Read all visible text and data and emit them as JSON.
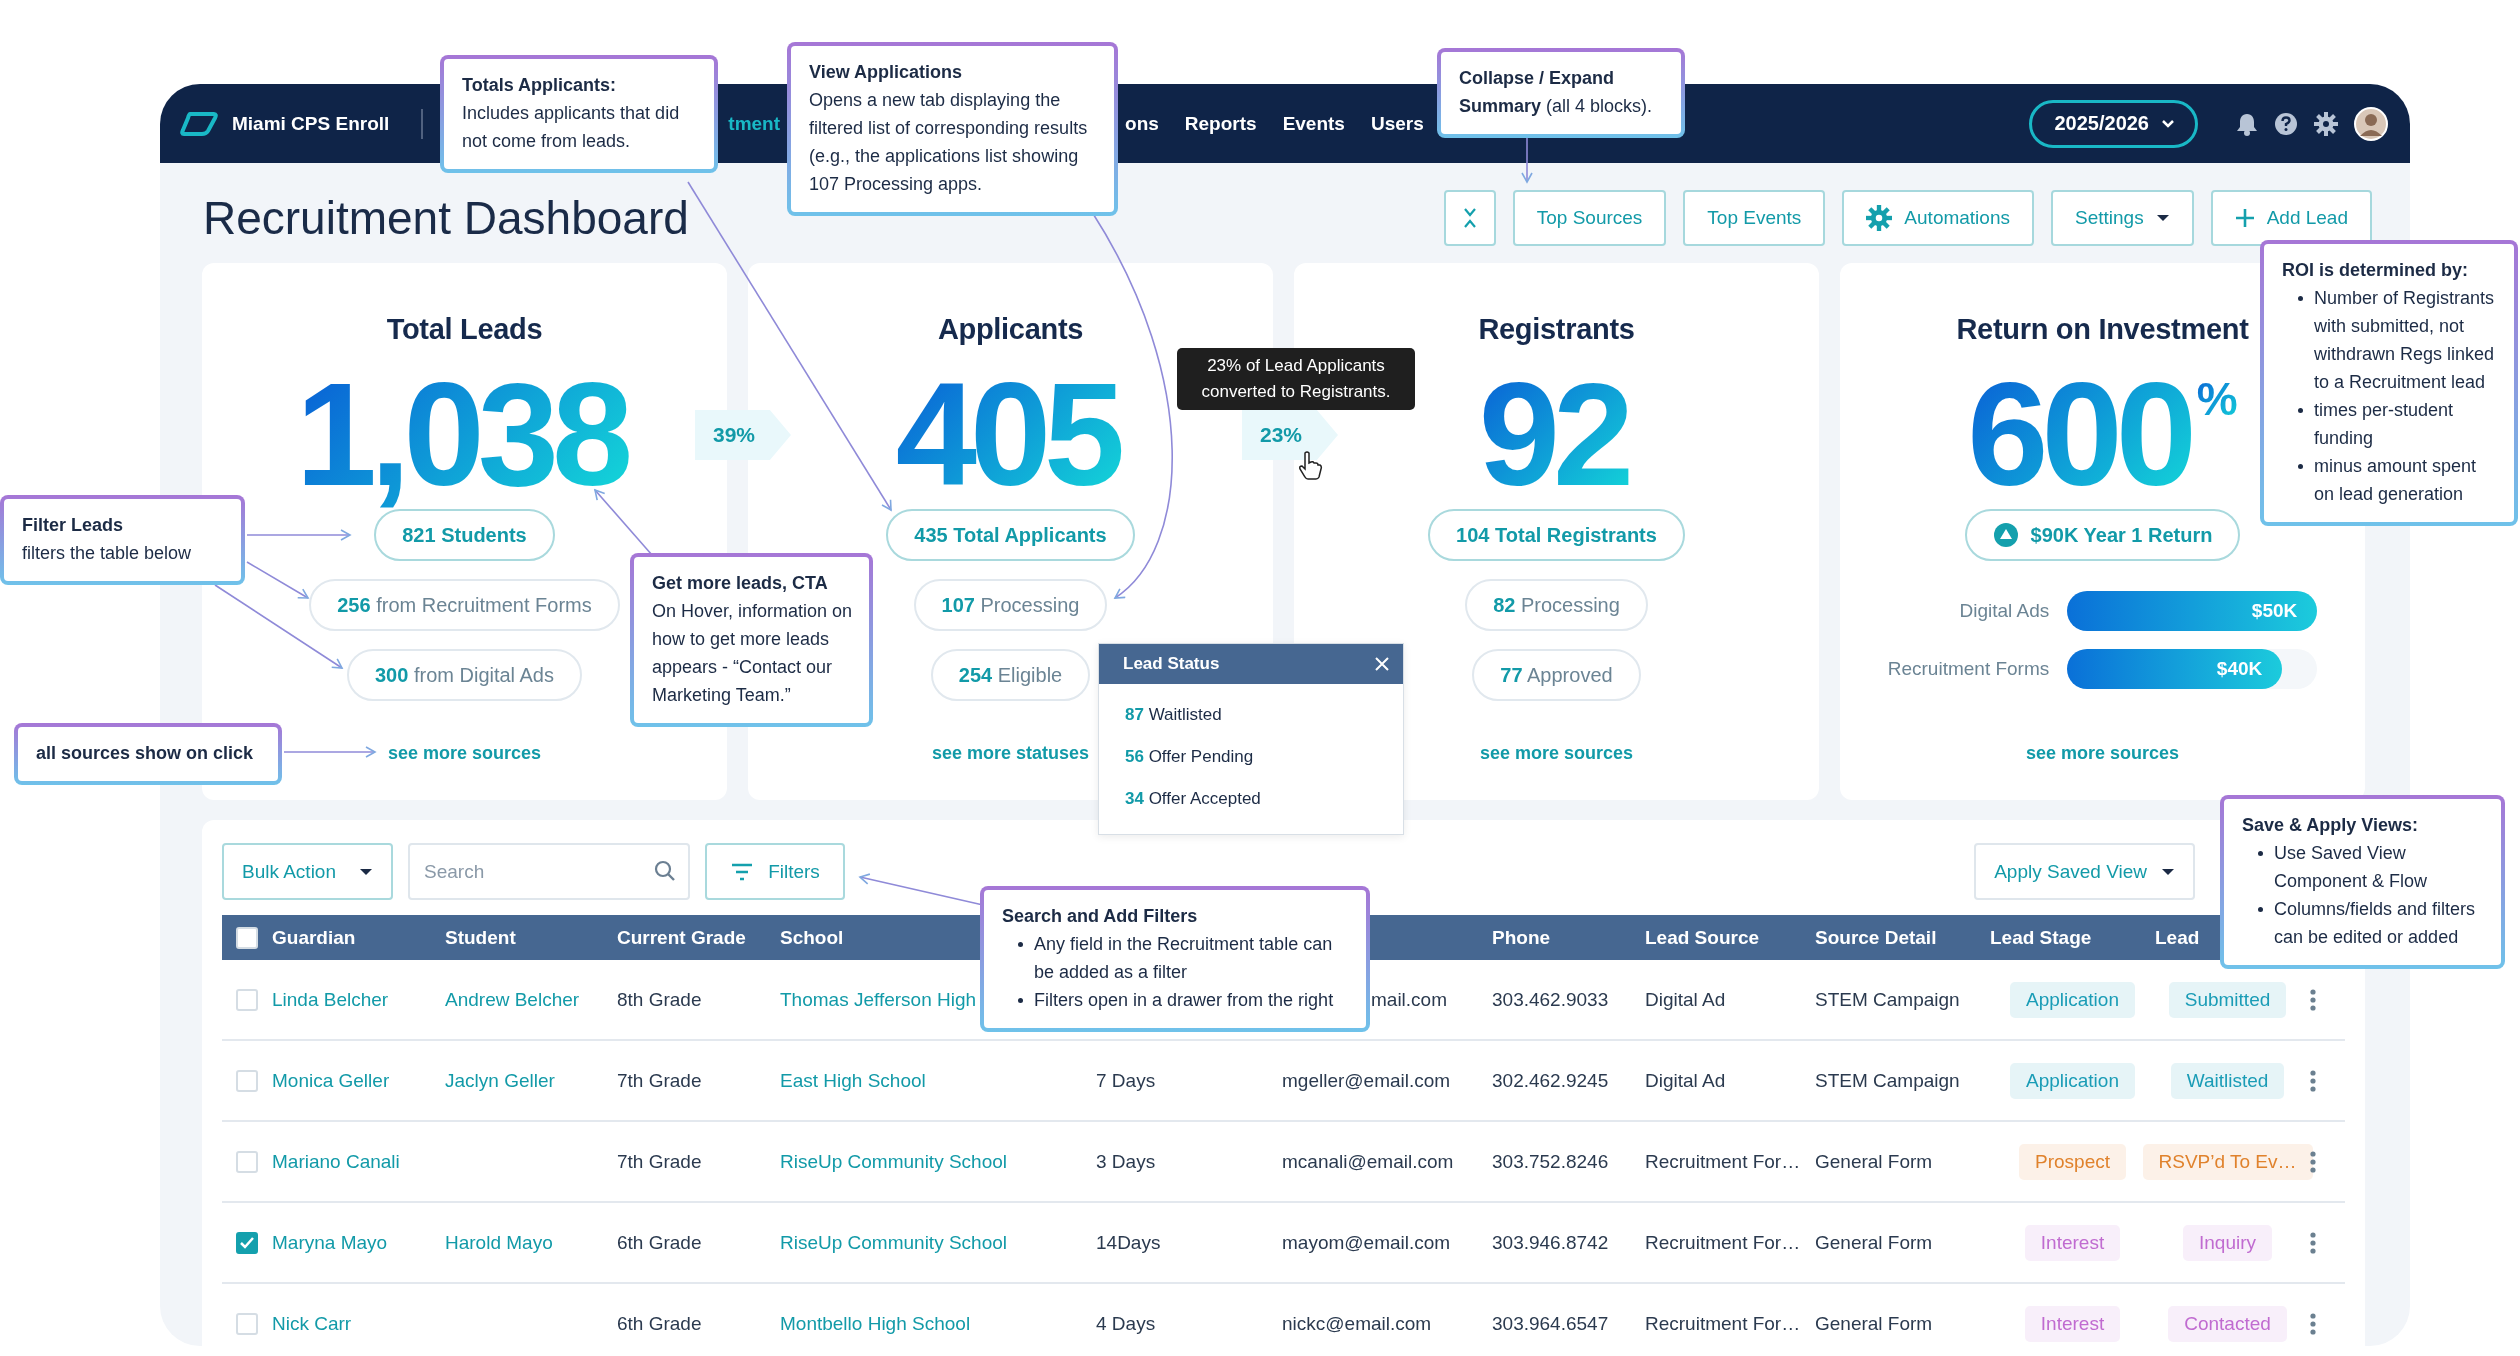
{
  "app": {
    "name": "Miami CPS Enroll"
  },
  "nav": [
    {
      "label": "tment",
      "selected": true
    },
    {
      "label": "ons",
      "selected": false
    },
    {
      "label": "Reports",
      "selected": false
    },
    {
      "label": "Events",
      "selected": false
    },
    {
      "label": "Users",
      "selected": false
    }
  ],
  "year": "2025/2026",
  "page_title": "Recruitment Dashboard",
  "actions": [
    {
      "kind": "collapse"
    },
    {
      "kind": "plain",
      "label": "Top Sources"
    },
    {
      "kind": "plain",
      "label": "Top Events"
    },
    {
      "kind": "gear",
      "label": "Automations"
    },
    {
      "kind": "menu",
      "label": "Settings"
    },
    {
      "kind": "add",
      "label": "Add Lead"
    }
  ],
  "cards": [
    {
      "kind": "stat",
      "title": "Total Leads",
      "value": "1,038",
      "primary": "821 Students",
      "items": [
        {
          "count": "256",
          "label": "from Recruitment Forms"
        },
        {
          "count": "300",
          "label": "from Digital Ads"
        }
      ],
      "link": "see more sources"
    },
    {
      "kind": "stat",
      "title": "Applicants",
      "value": "405",
      "primary": "435 Total Applicants",
      "items": [
        {
          "count": "107",
          "label": "Processing"
        },
        {
          "count": "254",
          "label": "Eligible"
        }
      ],
      "link": "see more statuses"
    },
    {
      "kind": "stat",
      "title": "Registrants",
      "value": "92",
      "primary": "104 Total Registrants",
      "items": [
        {
          "count": "82",
          "label": "Processing"
        },
        {
          "count": "77",
          "label": "Approved"
        }
      ],
      "link": "see more sources"
    },
    {
      "kind": "roi",
      "title": "Return on Investment",
      "value": "600",
      "unit": "%",
      "primary": "$90K Year 1 Return",
      "bars": [
        {
          "label": "Digital Ads",
          "value": "$50K",
          "level": 1
        },
        {
          "label": "Recruitment Forms",
          "value": "$40K",
          "level": 0.86
        }
      ],
      "link": "see more sources"
    }
  ],
  "conversions": [
    "39%",
    "23%"
  ],
  "tooltip": "23% of Lead Applicants converted to Registrants.",
  "lead_status_popup": {
    "title": "Lead Status",
    "items": [
      {
        "count": "87",
        "label": "Waitlisted"
      },
      {
        "count": "56",
        "label": "Offer Pending"
      },
      {
        "count": "34",
        "label": "Offer Accepted"
      }
    ]
  },
  "table": {
    "bulk_action": "Bulk Action",
    "search": {
      "placeholder": "Search"
    },
    "filters": "Filters",
    "saved_view": "Apply Saved View",
    "header_checked": false,
    "columns": {
      "guardian": "Guardian",
      "student": "Student",
      "grade": "Current Grade",
      "school": "School",
      "phone": "Phone",
      "lead_source": "Lead Source",
      "source_detail": "Source Detail",
      "lead_stage": "Lead Stage",
      "column_12": "Lead"
    },
    "rows": [
      {
        "checked": false,
        "guardian": "Linda Belcher",
        "student": "Andrew Belcher",
        "grade": "8th Grade",
        "school": "Thomas Jefferson High",
        "email": "mail.com",
        "email_cut": true,
        "phone": "303.462.9033",
        "lead_source": "Digital Ad",
        "source_detail": "STEM Campaign",
        "stage": {
          "label": "Application",
          "color": "#1a9cb6"
        },
        "status": {
          "label": "Submitted",
          "color": "#1a9cb6"
        }
      },
      {
        "checked": false,
        "guardian": "Monica Geller",
        "student": "Jaclyn Geller",
        "grade": "7th Grade",
        "school": "East High School",
        "days": "7 Days",
        "email": "mgeller@email.com",
        "phone": "302.462.9245",
        "lead_source": "Digital Ad",
        "source_detail": "STEM Campaign",
        "stage": {
          "label": "Application",
          "color": "#1a9cb6"
        },
        "status": {
          "label": "Waitlisted",
          "color": "#1a9cb6"
        }
      },
      {
        "checked": false,
        "guardian": "Mariano Canali",
        "grade": "7th Grade",
        "school": "RiseUp Community School",
        "days": "3 Days",
        "email": "mcanali@email.com",
        "phone": "303.752.8246",
        "lead_source": "Recruitment For…",
        "source_detail": "General Form",
        "stage": {
          "label": "Prospect",
          "color": "#e0822c"
        },
        "status": {
          "label": "RSVP’d To Ev…",
          "color": "#e0822c"
        }
      },
      {
        "checked": true,
        "guardian": "Maryna Mayo",
        "student": "Harold Mayo",
        "grade": "6th Grade",
        "school": "RiseUp Community School",
        "days": "14Days",
        "email": "mayom@email.com",
        "phone": "303.946.8742",
        "lead_source": "Recruitment For…",
        "source_detail": "General Form",
        "stage": {
          "label": "Interest",
          "color": "#c06bd0"
        },
        "status": {
          "label": "Inquiry",
          "color": "#c06bd0"
        }
      },
      {
        "checked": false,
        "guardian": "Nick Carr",
        "grade": "6th Grade",
        "school": "Montbello High School",
        "days": "4 Days",
        "email": "nickc@email.com",
        "phone": "303.964.6547",
        "lead_source": "Recruitment For…",
        "source_detail": "General Form",
        "stage": {
          "label": "Interest",
          "color": "#c06bd0"
        },
        "status": {
          "label": "Contacted",
          "color": "#c06bd0"
        }
      }
    ]
  },
  "annotations": [
    {
      "title": "Totals Applicants:",
      "body": "Includes applicants that did not come from leads."
    },
    {
      "title": "View Applications",
      "body": "Opens a new tab displaying the filtered list of corresponding results (e.g., the applications list showing 107 Processing apps."
    },
    {
      "body": "**Collapse / Expand Summary** (all 4 blocks)."
    },
    {
      "title": "ROI is determined by:",
      "bullets": [
        "Number of Registrants with submitted, not withdrawn Regs linked to a Recruitment lead",
        "times per-student funding",
        "minus amount spent on lead generation"
      ]
    },
    {
      "title": "Filter Leads",
      "body": "filters the table below"
    },
    {
      "title": "Get more leads, CTA",
      "body": "On Hover, information on how to get more leads appears - “Contact our Marketing Team.”"
    },
    {
      "title": "all sources show on click"
    },
    {
      "title": "Search and Add Filters",
      "bullets": [
        "Any field in the Recruitment table can be added as a filter",
        "Filters open in a drawer from the right"
      ]
    },
    {
      "title": "Save & Apply Views:",
      "bullets": [
        "Use Saved View Component & Flow",
        "Columns/fields and filters can be edited or added"
      ]
    }
  ]
}
